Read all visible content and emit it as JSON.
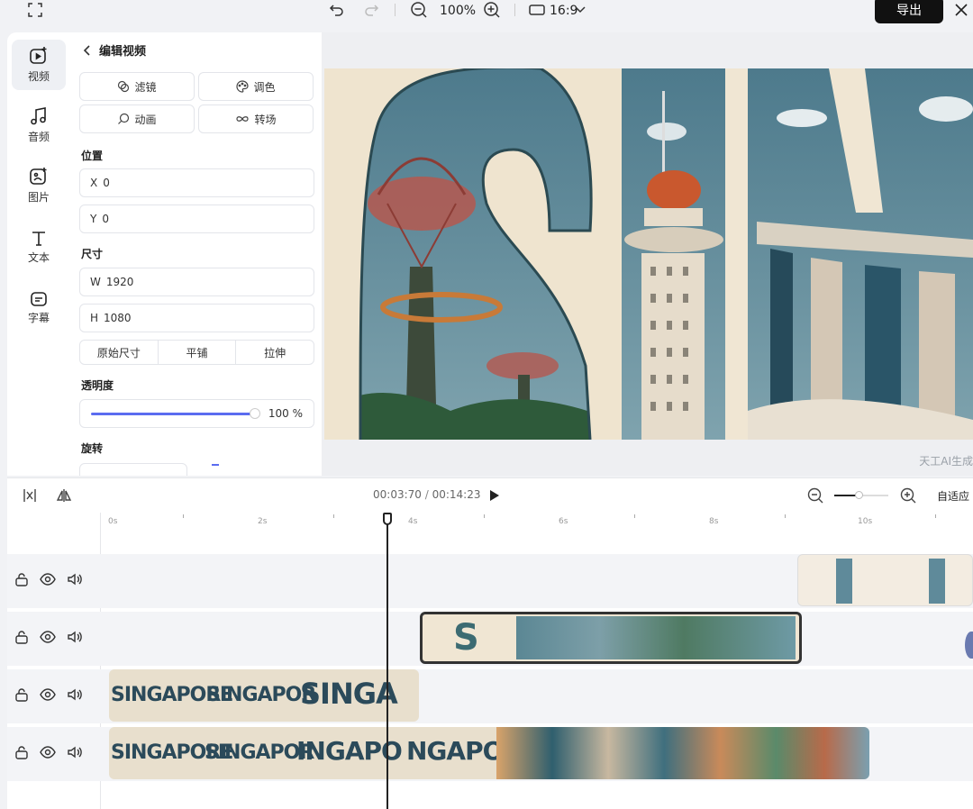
{
  "topbar": {
    "zoom": "100%",
    "ratio": "16:9",
    "export_label": "导出"
  },
  "rail": {
    "items": [
      {
        "label": "视频",
        "icon": "video-icon",
        "active": true
      },
      {
        "label": "音频",
        "icon": "music-icon",
        "active": false
      },
      {
        "label": "图片",
        "icon": "image-icon",
        "active": false
      },
      {
        "label": "文本",
        "icon": "text-icon",
        "active": false
      },
      {
        "label": "字幕",
        "icon": "subtitle-icon",
        "active": false
      }
    ]
  },
  "panel": {
    "title": "编辑视频",
    "buttons": {
      "filter": "滤镜",
      "color": "调色",
      "animation": "动画",
      "transition": "转场"
    },
    "position_label": "位置",
    "x_key": "X",
    "x_value": "0",
    "y_key": "Y",
    "y_value": "0",
    "size_label": "尺寸",
    "w_key": "W",
    "w_value": "1920",
    "h_key": "H",
    "h_value": "1080",
    "fit_modes": [
      "原始尺寸",
      "平铺",
      "拉伸"
    ],
    "opacity_label": "透明度",
    "opacity_value": "100 %",
    "opacity": 1.0,
    "rotation_label": "旋转"
  },
  "preview": {
    "watermark": "天工AI生成"
  },
  "timeline": {
    "current_time": "00:03:70",
    "separator": " / ",
    "total_time": "00:14:23",
    "fit_label": "自适应",
    "ruler_labels": [
      "0s",
      "2s",
      "4s",
      "6s",
      "8s",
      "10s"
    ],
    "clips": {
      "text_a": "SINGAPORE",
      "text_b": "SINGAPOR",
      "text_c": "SINGA",
      "text_d": "INGAPO",
      "text_e": "NGAPO",
      "s_letter": "S"
    }
  },
  "colors": {
    "accent": "#5b6cf0",
    "export_bg": "#111111",
    "sky": "#5f8a9a",
    "cream": "#f0e6d3"
  }
}
